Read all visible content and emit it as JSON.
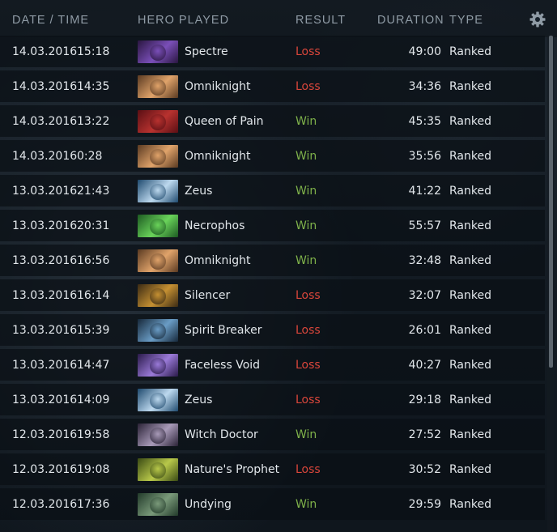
{
  "header": {
    "date_time": "DATE / TIME",
    "hero_played": "HERO PLAYED",
    "result": "RESULT",
    "duration": "DURATION",
    "type": "TYPE",
    "settings_icon": "gear-icon"
  },
  "matches": [
    {
      "date": "14.03.2016",
      "time": "15:18",
      "hero": "Spectre",
      "result": "Loss",
      "duration": "49:00",
      "type": "Ranked"
    },
    {
      "date": "14.03.2016",
      "time": "14:35",
      "hero": "Omniknight",
      "result": "Loss",
      "duration": "34:36",
      "type": "Ranked"
    },
    {
      "date": "14.03.2016",
      "time": "13:22",
      "hero": "Queen of Pain",
      "result": "Win",
      "duration": "45:35",
      "type": "Ranked"
    },
    {
      "date": "14.03.2016",
      "time": "0:28",
      "hero": "Omniknight",
      "result": "Win",
      "duration": "35:56",
      "type": "Ranked"
    },
    {
      "date": "13.03.2016",
      "time": "21:43",
      "hero": "Zeus",
      "result": "Win",
      "duration": "41:22",
      "type": "Ranked"
    },
    {
      "date": "13.03.2016",
      "time": "20:31",
      "hero": "Necrophos",
      "result": "Win",
      "duration": "55:57",
      "type": "Ranked"
    },
    {
      "date": "13.03.2016",
      "time": "16:56",
      "hero": "Omniknight",
      "result": "Win",
      "duration": "32:48",
      "type": "Ranked"
    },
    {
      "date": "13.03.2016",
      "time": "16:14",
      "hero": "Silencer",
      "result": "Loss",
      "duration": "32:07",
      "type": "Ranked"
    },
    {
      "date": "13.03.2016",
      "time": "15:39",
      "hero": "Spirit Breaker",
      "result": "Loss",
      "duration": "26:01",
      "type": "Ranked"
    },
    {
      "date": "13.03.2016",
      "time": "14:47",
      "hero": "Faceless Void",
      "result": "Loss",
      "duration": "40:27",
      "type": "Ranked"
    },
    {
      "date": "13.03.2016",
      "time": "14:09",
      "hero": "Zeus",
      "result": "Loss",
      "duration": "29:18",
      "type": "Ranked"
    },
    {
      "date": "12.03.2016",
      "time": "19:58",
      "hero": "Witch Doctor",
      "result": "Win",
      "duration": "27:52",
      "type": "Ranked"
    },
    {
      "date": "12.03.2016",
      "time": "19:08",
      "hero": "Nature's Prophet",
      "result": "Loss",
      "duration": "30:52",
      "type": "Ranked"
    },
    {
      "date": "12.03.2016",
      "time": "17:36",
      "hero": "Undying",
      "result": "Win",
      "duration": "29:59",
      "type": "Ranked"
    }
  ],
  "colors": {
    "win": "#7fb24a",
    "loss": "#d9463b",
    "header_text": "#8f9ba5"
  },
  "hero_portraits": {
    "Spectre": {
      "bg": "#2a1640",
      "accent": "#7a4fb8"
    },
    "Omniknight": {
      "bg": "#5a3a22",
      "accent": "#e0a36a"
    },
    "Queen of Pain": {
      "bg": "#5a0f14",
      "accent": "#b8322f"
    },
    "Zeus": {
      "bg": "#1f4a6e",
      "accent": "#bcd8ee"
    },
    "Necrophos": {
      "bg": "#1d5a22",
      "accent": "#6ad35a"
    },
    "Silencer": {
      "bg": "#3a2a14",
      "accent": "#c59032"
    },
    "Spirit Breaker": {
      "bg": "#16283a",
      "accent": "#6a9cc5"
    },
    "Faceless Void": {
      "bg": "#2a1a4a",
      "accent": "#9a7ad8"
    },
    "Witch Doctor": {
      "bg": "#2a2236",
      "accent": "#a89ab8"
    },
    "Nature's Prophet": {
      "bg": "#3a4a14",
      "accent": "#b8c84a"
    },
    "Undying": {
      "bg": "#223a2a",
      "accent": "#7a9a7a"
    }
  }
}
